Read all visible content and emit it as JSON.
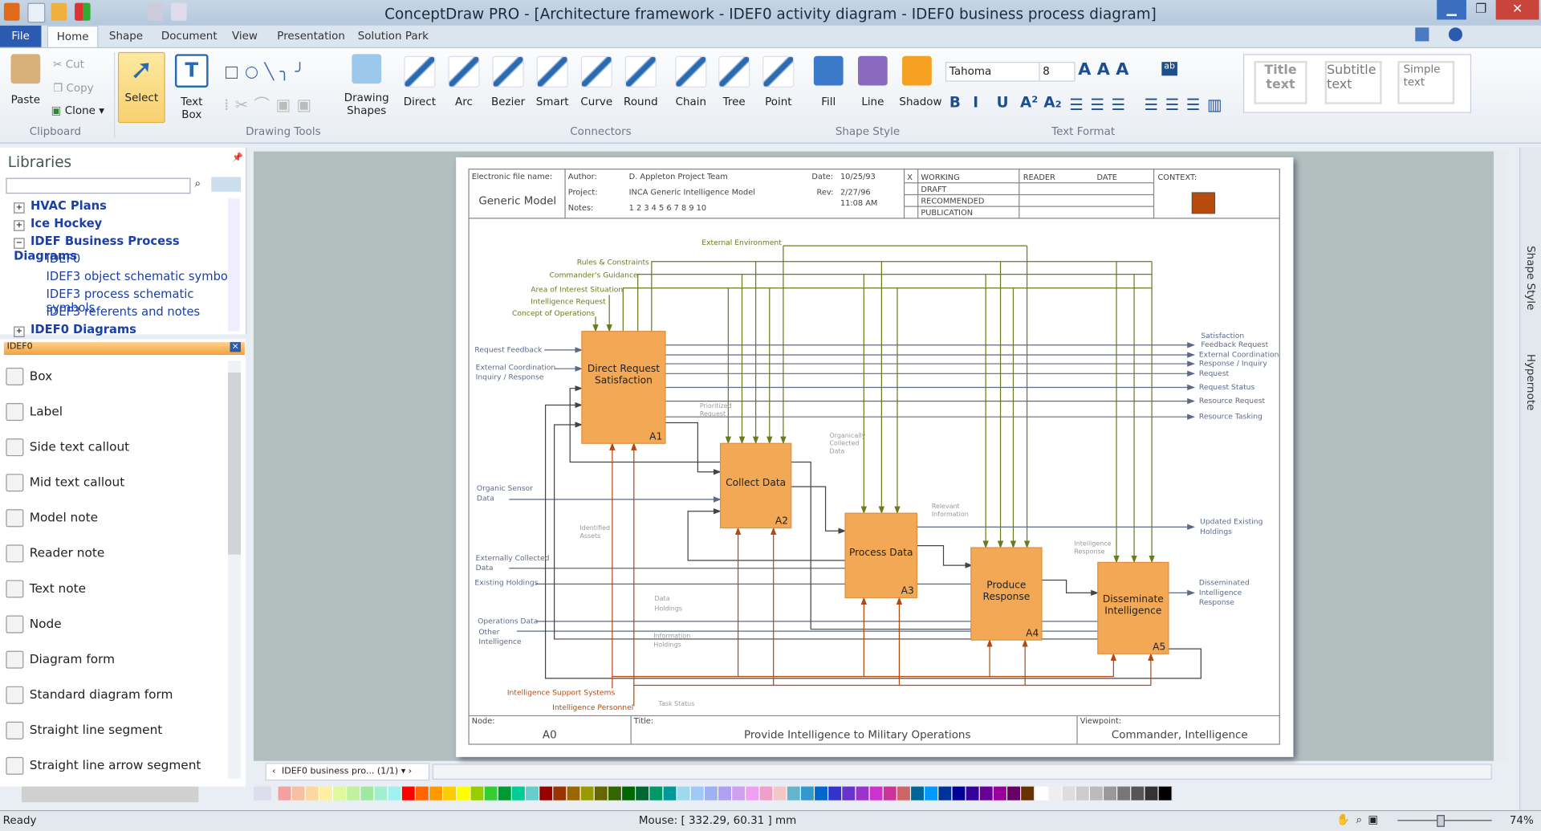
{
  "window": {
    "title": "ConceptDraw PRO - [Architecture framework - IDEF0 activity diagram - IDEF0 business process diagram]"
  },
  "tabs": [
    "File",
    "Home",
    "Shape",
    "Document",
    "View",
    "Presentation",
    "Solution Park"
  ],
  "ribbon": {
    "clipboard": {
      "paste": "Paste",
      "cut": "Cut",
      "copy": "Copy",
      "clone": "Clone",
      "group": "Clipboard"
    },
    "select": "Select",
    "textbox": [
      "Text",
      "Box"
    ],
    "drawing_tools": "Drawing Tools",
    "drawing_shapes": [
      "Drawing",
      "Shapes"
    ],
    "connectors": {
      "items": [
        "Direct",
        "Arc",
        "Bezier",
        "Smart",
        "Curve",
        "Round",
        "Chain",
        "Tree",
        "Point"
      ],
      "group": "Connectors"
    },
    "shape_style": {
      "items": [
        "Fill",
        "Line",
        "Shadow"
      ],
      "group": "Shape Style"
    },
    "text_format": {
      "font": "Tahoma",
      "size": "8",
      "group": "Text Format",
      "buttons": [
        "B",
        "I",
        "U",
        "A²",
        "A₂"
      ]
    },
    "styles": [
      [
        "Title",
        "text"
      ],
      [
        "Subtitle",
        "text"
      ],
      [
        "Simple",
        "text"
      ]
    ]
  },
  "libraries": {
    "title": "Libraries",
    "tree": [
      {
        "label": "HVAC Plans",
        "level": 0,
        "sign": "+"
      },
      {
        "label": "Ice Hockey",
        "level": 0,
        "sign": "+"
      },
      {
        "label": "IDEF Business Process Diagrams",
        "level": 0,
        "sign": "−"
      },
      {
        "label": "IDEF0",
        "level": 1
      },
      {
        "label": "IDEF3 object schematic symbols",
        "level": 1
      },
      {
        "label": "IDEF3 process schematic symbols",
        "level": 1
      },
      {
        "label": "IDEF3 referents and notes",
        "level": 1
      },
      {
        "label": "IDEF0 Diagrams",
        "level": 0,
        "sign": "+"
      }
    ]
  },
  "library": {
    "name": "IDEF0",
    "items": [
      "Box",
      "Label",
      "Side text callout",
      "Mid text callout",
      "Model note",
      "Reader note",
      "Text note",
      "Node",
      "Diagram form",
      "Standard diagram form",
      "Straight line segment",
      "Straight line arrow segment"
    ]
  },
  "diagram": {
    "header": {
      "efn_label": "Electronic file name:",
      "model": "Generic Model",
      "author_label": "Author:",
      "author": "D. Appleton Project Team",
      "project_label": "Project:",
      "project": "INCA Generic Intelligence Model",
      "notes_label": "Notes:",
      "notes": "1 2 3 4 5 6 7 8 9 10",
      "date_label": "Date:",
      "date": "10/25/93",
      "rev_label": "Rev:",
      "rev": "2/27/96",
      "time": "11:08 AM",
      "x": "X",
      "statuses": [
        "WORKING",
        "DRAFT",
        "RECOMMENDED",
        "PUBLICATION"
      ],
      "reader": "READER",
      "date2": "DATE",
      "context": "CONTEXT:",
      "context_color": "#b84a0c"
    },
    "boxes": [
      {
        "title": [
          "Direct Request",
          "Satisfaction"
        ],
        "id": "A1"
      },
      {
        "title": [
          "Collect Data"
        ],
        "id": "A2"
      },
      {
        "title": [
          "Process Data"
        ],
        "id": "A3"
      },
      {
        "title": [
          "Produce",
          "Response"
        ],
        "id": "A4"
      },
      {
        "title": [
          "Disseminate",
          "Intelligence"
        ],
        "id": "A5"
      }
    ],
    "controls": [
      "External Environment",
      "Rules & Constraints",
      "Commander's Guidance",
      "Area of Interest Situation",
      "Intelligence Request",
      "Concept of Operations"
    ],
    "inputs": [
      "Request Feedback",
      "External Coordination",
      "Inquiry / Response",
      "Organic Sensor",
      "Data",
      "Externally Collected",
      "Data",
      "Existing Holdings",
      "Operations Data",
      "Other",
      "Intelligence"
    ],
    "outputs": [
      "Satisfaction",
      "Feedback Request",
      "External Coordination",
      "Response / Inquiry",
      "Request",
      "Request Status",
      "Resource Request",
      "Resource Tasking",
      "Updated Existing",
      "Holdings",
      "Disseminated",
      "Intelligence",
      "Response"
    ],
    "mechanisms": [
      "Intelligence Support Systems",
      "Intelligence Personnel"
    ],
    "annotations": [
      "Prioritized",
      "Request",
      "Organically",
      "Collected",
      "Data",
      "Relevant",
      "Information",
      "Intelligence",
      "Response",
      "Identified",
      "Assets",
      "Data",
      "Holdings",
      "Information",
      "Holdings",
      "Task Status"
    ],
    "footer": {
      "node_label": "Node:",
      "node": "A0",
      "title_label": "Title:",
      "title": "Provide Intelligence to Military Operations",
      "viewpoint_label": "Viewpoint:",
      "viewpoint": "Commander, Intelligence"
    },
    "colors": {
      "box": "#f2a854",
      "control": "#6b7a1e",
      "input": "#5b6a88",
      "mechanism": "#b5480e",
      "feedback": "#444444"
    }
  },
  "page_tab": "IDEF0 business pro... (1/1)",
  "side_tabs": [
    "Shape Style",
    "Hypernote"
  ],
  "palette": [
    "#f4a0a0",
    "#f8c0a0",
    "#fcd8a0",
    "#fcf0a0",
    "#e0f8a0",
    "#c0f0a0",
    "#a0e8a0",
    "#a0f0d0",
    "#a0f0f0",
    "#ff0000",
    "#ff6600",
    "#ff9900",
    "#ffcc00",
    "#ffff00",
    "#99cc00",
    "#33cc33",
    "#009933",
    "#00cc99",
    "#66cccc",
    "#990000",
    "#993300",
    "#996600",
    "#999900",
    "#666600",
    "#336600",
    "#006600",
    "#006633",
    "#009966",
    "#009999",
    "#a0d8f0",
    "#a0c8f8",
    "#a0b0f0",
    "#b0a0f0",
    "#d0a0f0",
    "#f0a0f0",
    "#f0a0c8",
    "#f0c8c8",
    "#66b3cc",
    "#3399cc",
    "#0066cc",
    "#3333cc",
    "#6633cc",
    "#9933cc",
    "#cc33cc",
    "#cc3399",
    "#cc6666",
    "#006699",
    "#0099ff",
    "#003399",
    "#000099",
    "#330099",
    "#660099",
    "#990099",
    "#660066",
    "#663300",
    "#ffffff",
    "#eeeeee",
    "#dddddd",
    "#cccccc",
    "#bbbbbb",
    "#999999",
    "#777777",
    "#555555",
    "#333333",
    "#000000"
  ],
  "status": {
    "ready": "Ready",
    "mouse": "Mouse: [ 332.29, 60.31 ] mm",
    "zoom": "74%"
  }
}
